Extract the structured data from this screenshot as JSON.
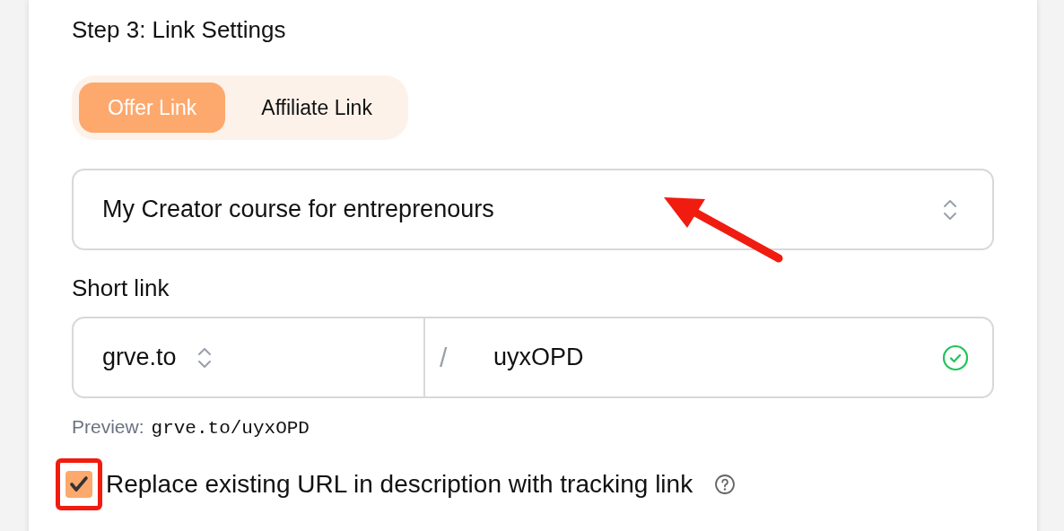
{
  "step_title": "Step 3: Link Settings",
  "tabs": [
    {
      "label": "Offer Link",
      "selected": true
    },
    {
      "label": "Affiliate Link",
      "selected": false
    }
  ],
  "offer_select": {
    "value": "My Creator course for entreprenours"
  },
  "short_link": {
    "label": "Short link",
    "domain": "grve.to",
    "separator": "/",
    "slug": "uyxOPD",
    "valid": true
  },
  "preview": {
    "label": "Preview:",
    "value": "grve.to/uyxOPD"
  },
  "replace_url": {
    "label": "Replace existing URL in description with tracking link",
    "checked": true
  }
}
